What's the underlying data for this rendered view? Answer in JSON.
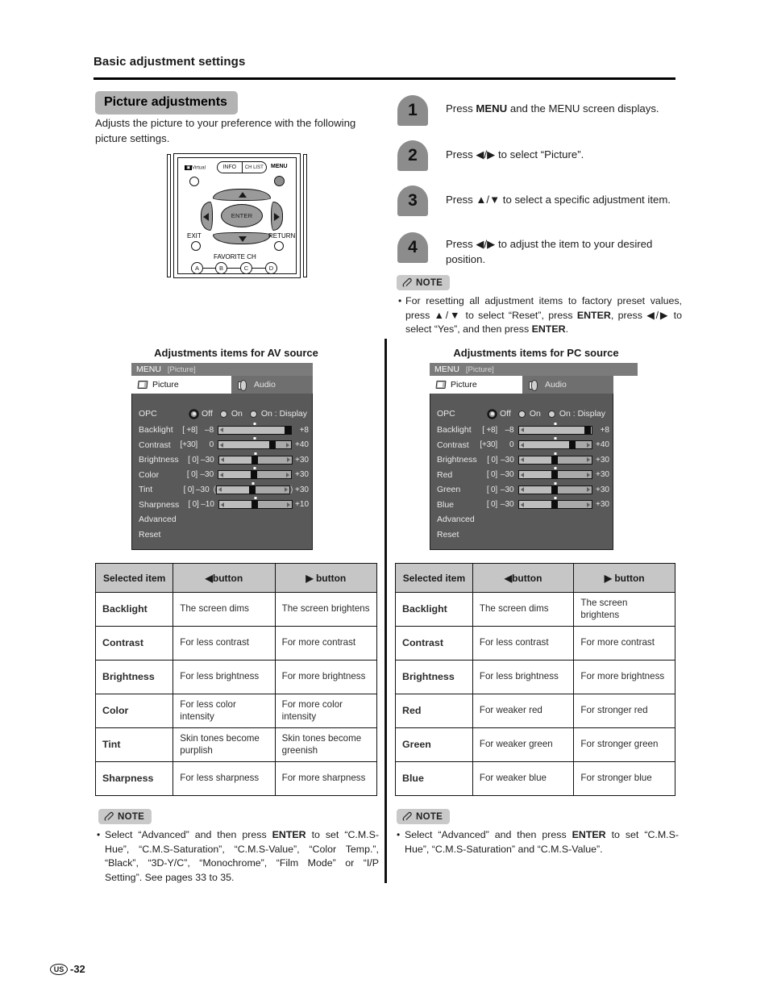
{
  "header": {
    "title": "Basic adjustment settings"
  },
  "section": {
    "chip_label": "Picture adjustments",
    "intro": "Adjusts the picture to your preference with the following picture settings."
  },
  "remote": {
    "labels": {
      "virtual": "Virtual",
      "dd_logo": "DD",
      "info": "INFO",
      "ch_list": "CH LIST",
      "menu": "MENU",
      "enter": "ENTER",
      "exit": "EXIT",
      "return": "RETURN",
      "favorite_ch": "FAVORITE CH",
      "a": "A",
      "b": "B",
      "c": "C",
      "d": "D"
    }
  },
  "steps": [
    {
      "number": "1",
      "text_html": "Press <b class=\"k\">MENU</b> and the MENU screen displays."
    },
    {
      "number": "2",
      "text_html": "Press ◀/▶ to select “Picture”."
    },
    {
      "number": "3",
      "text_html": "Press ▲/▼ to select a specific adjustment item."
    },
    {
      "number": "4",
      "text_html": "Press ◀/▶ to adjust the item to your desired position."
    }
  ],
  "note_top": {
    "label": "NOTE",
    "bullet": "•",
    "text_html": "For resetting all adjustment items to factory preset values, press ▲/▼ to select “Reset”, press <b class=\"k\">ENTER</b>, press ◀/▶ to select “Yes”, and then press <b class=\"k\">ENTER</b>."
  },
  "av": {
    "sub_title": "Adjustments items for AV source",
    "osd": {
      "menu_label": "MENU",
      "breadcrumb": "[Picture]",
      "tab_picture": "Picture",
      "tab_audio": "Audio",
      "opc": {
        "label": "OPC",
        "options": [
          {
            "label": "Off",
            "selected": true
          },
          {
            "label": "On",
            "selected": false
          },
          {
            "label": "On : Display",
            "selected": false
          }
        ]
      },
      "rows": [
        {
          "label": "Backlight",
          "current": "[ +8]",
          "min": "–8",
          "max": "+8",
          "fill_pct": 100,
          "thumb_pct": 95,
          "paren": false
        },
        {
          "label": "Contrast",
          "current": "[+30]",
          "min": "0",
          "max": "+40",
          "fill_pct": 75,
          "thumb_pct": 74,
          "paren": false
        },
        {
          "label": "Brightness",
          "current": "[  0]",
          "min": "–30",
          "max": "+30",
          "fill_pct": 50,
          "thumb_pct": 49,
          "paren": false
        },
        {
          "label": "Color",
          "current": "[  0]",
          "min": "–30",
          "max": "+30",
          "fill_pct": 50,
          "thumb_pct": 49,
          "paren": false
        },
        {
          "label": "Tint",
          "current": "[  0]",
          "min": "–30",
          "max": "+30",
          "fill_pct": 50,
          "thumb_pct": 49,
          "paren": true
        },
        {
          "label": "Sharpness",
          "current": "[  0]",
          "min": "–10",
          "max": "+10",
          "fill_pct": 50,
          "thumb_pct": 49,
          "paren": false
        }
      ],
      "plain_rows": [
        "Advanced",
        "Reset"
      ]
    },
    "table": {
      "headers": [
        "Selected item",
        "◀button",
        "▶ button"
      ],
      "rows": [
        {
          "item": "Backlight",
          "left": "The screen dims",
          "right": "The screen brightens"
        },
        {
          "item": "Contrast",
          "left": "For less contrast",
          "right": "For more contrast"
        },
        {
          "item": "Brightness",
          "left": "For less brightness",
          "right": "For more brightness"
        },
        {
          "item": "Color",
          "left": "For less color intensity",
          "right": "For more color intensity"
        },
        {
          "item": "Tint",
          "left": "Skin tones become purplish",
          "right": "Skin tones become greenish"
        },
        {
          "item": "Sharpness",
          "left": "For less sharpness",
          "right": "For more sharpness"
        }
      ]
    },
    "note": {
      "label": "NOTE",
      "bullet": "•",
      "text_html": "Select “Advanced” and then press <b class=\"k\">ENTER</b> to set “C.M.S-Hue”, “C.M.S-Saturation”, “C.M.S-Value”, “Color Temp.”, “Black”, “3D-Y/C”, “Monochrome”, “Film Mode” or “I/P Setting”. See pages 33 to 35."
    }
  },
  "pc": {
    "sub_title": "Adjustments items for PC source",
    "osd": {
      "menu_label": "MENU",
      "breadcrumb": "[Picture]",
      "tab_picture": "Picture",
      "tab_audio": "Audio",
      "opc": {
        "label": "OPC",
        "options": [
          {
            "label": "Off",
            "selected": true
          },
          {
            "label": "On",
            "selected": false
          },
          {
            "label": "On : Display",
            "selected": false
          }
        ]
      },
      "rows": [
        {
          "label": "Backlight",
          "current": "[ +8]",
          "min": "–8",
          "max": "+8",
          "fill_pct": 100,
          "thumb_pct": 95,
          "paren": false
        },
        {
          "label": "Contrast",
          "current": "[+30]",
          "min": "0",
          "max": "+40",
          "fill_pct": 75,
          "thumb_pct": 74,
          "paren": false
        },
        {
          "label": "Brightness",
          "current": "[  0]",
          "min": "–30",
          "max": "+30",
          "fill_pct": 50,
          "thumb_pct": 49,
          "paren": false
        },
        {
          "label": "Red",
          "current": "[  0]",
          "min": "–30",
          "max": "+30",
          "fill_pct": 50,
          "thumb_pct": 49,
          "paren": false
        },
        {
          "label": "Green",
          "current": "[  0]",
          "min": "–30",
          "max": "+30",
          "fill_pct": 50,
          "thumb_pct": 49,
          "paren": false
        },
        {
          "label": "Blue",
          "current": "[  0]",
          "min": "–30",
          "max": "+30",
          "fill_pct": 50,
          "thumb_pct": 49,
          "paren": false
        }
      ],
      "plain_rows": [
        "Advanced",
        "Reset"
      ]
    },
    "table": {
      "headers": [
        "Selected item",
        "◀button",
        "▶ button"
      ],
      "rows": [
        {
          "item": "Backlight",
          "left": "The screen dims",
          "right": "The screen brightens"
        },
        {
          "item": "Contrast",
          "left": "For less contrast",
          "right": "For more contrast"
        },
        {
          "item": "Brightness",
          "left": "For less brightness",
          "right": "For more brightness"
        },
        {
          "item": "Red",
          "left": "For weaker red",
          "right": "For stronger red"
        },
        {
          "item": "Green",
          "left": "For weaker green",
          "right": "For stronger green"
        },
        {
          "item": "Blue",
          "left": "For weaker blue",
          "right": "For stronger blue"
        }
      ]
    },
    "note": {
      "label": "NOTE",
      "bullet": "•",
      "text_html": "Select “Advanced” and then press <b class=\"k\">ENTER</b> to set “C.M.S-Hue”, “C.M.S-Saturation” and “C.M.S-Value”."
    }
  },
  "footer": {
    "region": "US",
    "page": "-32"
  },
  "colors": {
    "chip_gray": "#b3b3b3",
    "step_gray": "#8c8c8c",
    "note_gray": "#c9c9c9",
    "osd_body": "#595959",
    "osd_title": "#7b7b7b",
    "table_header": "#c6c6c6"
  }
}
